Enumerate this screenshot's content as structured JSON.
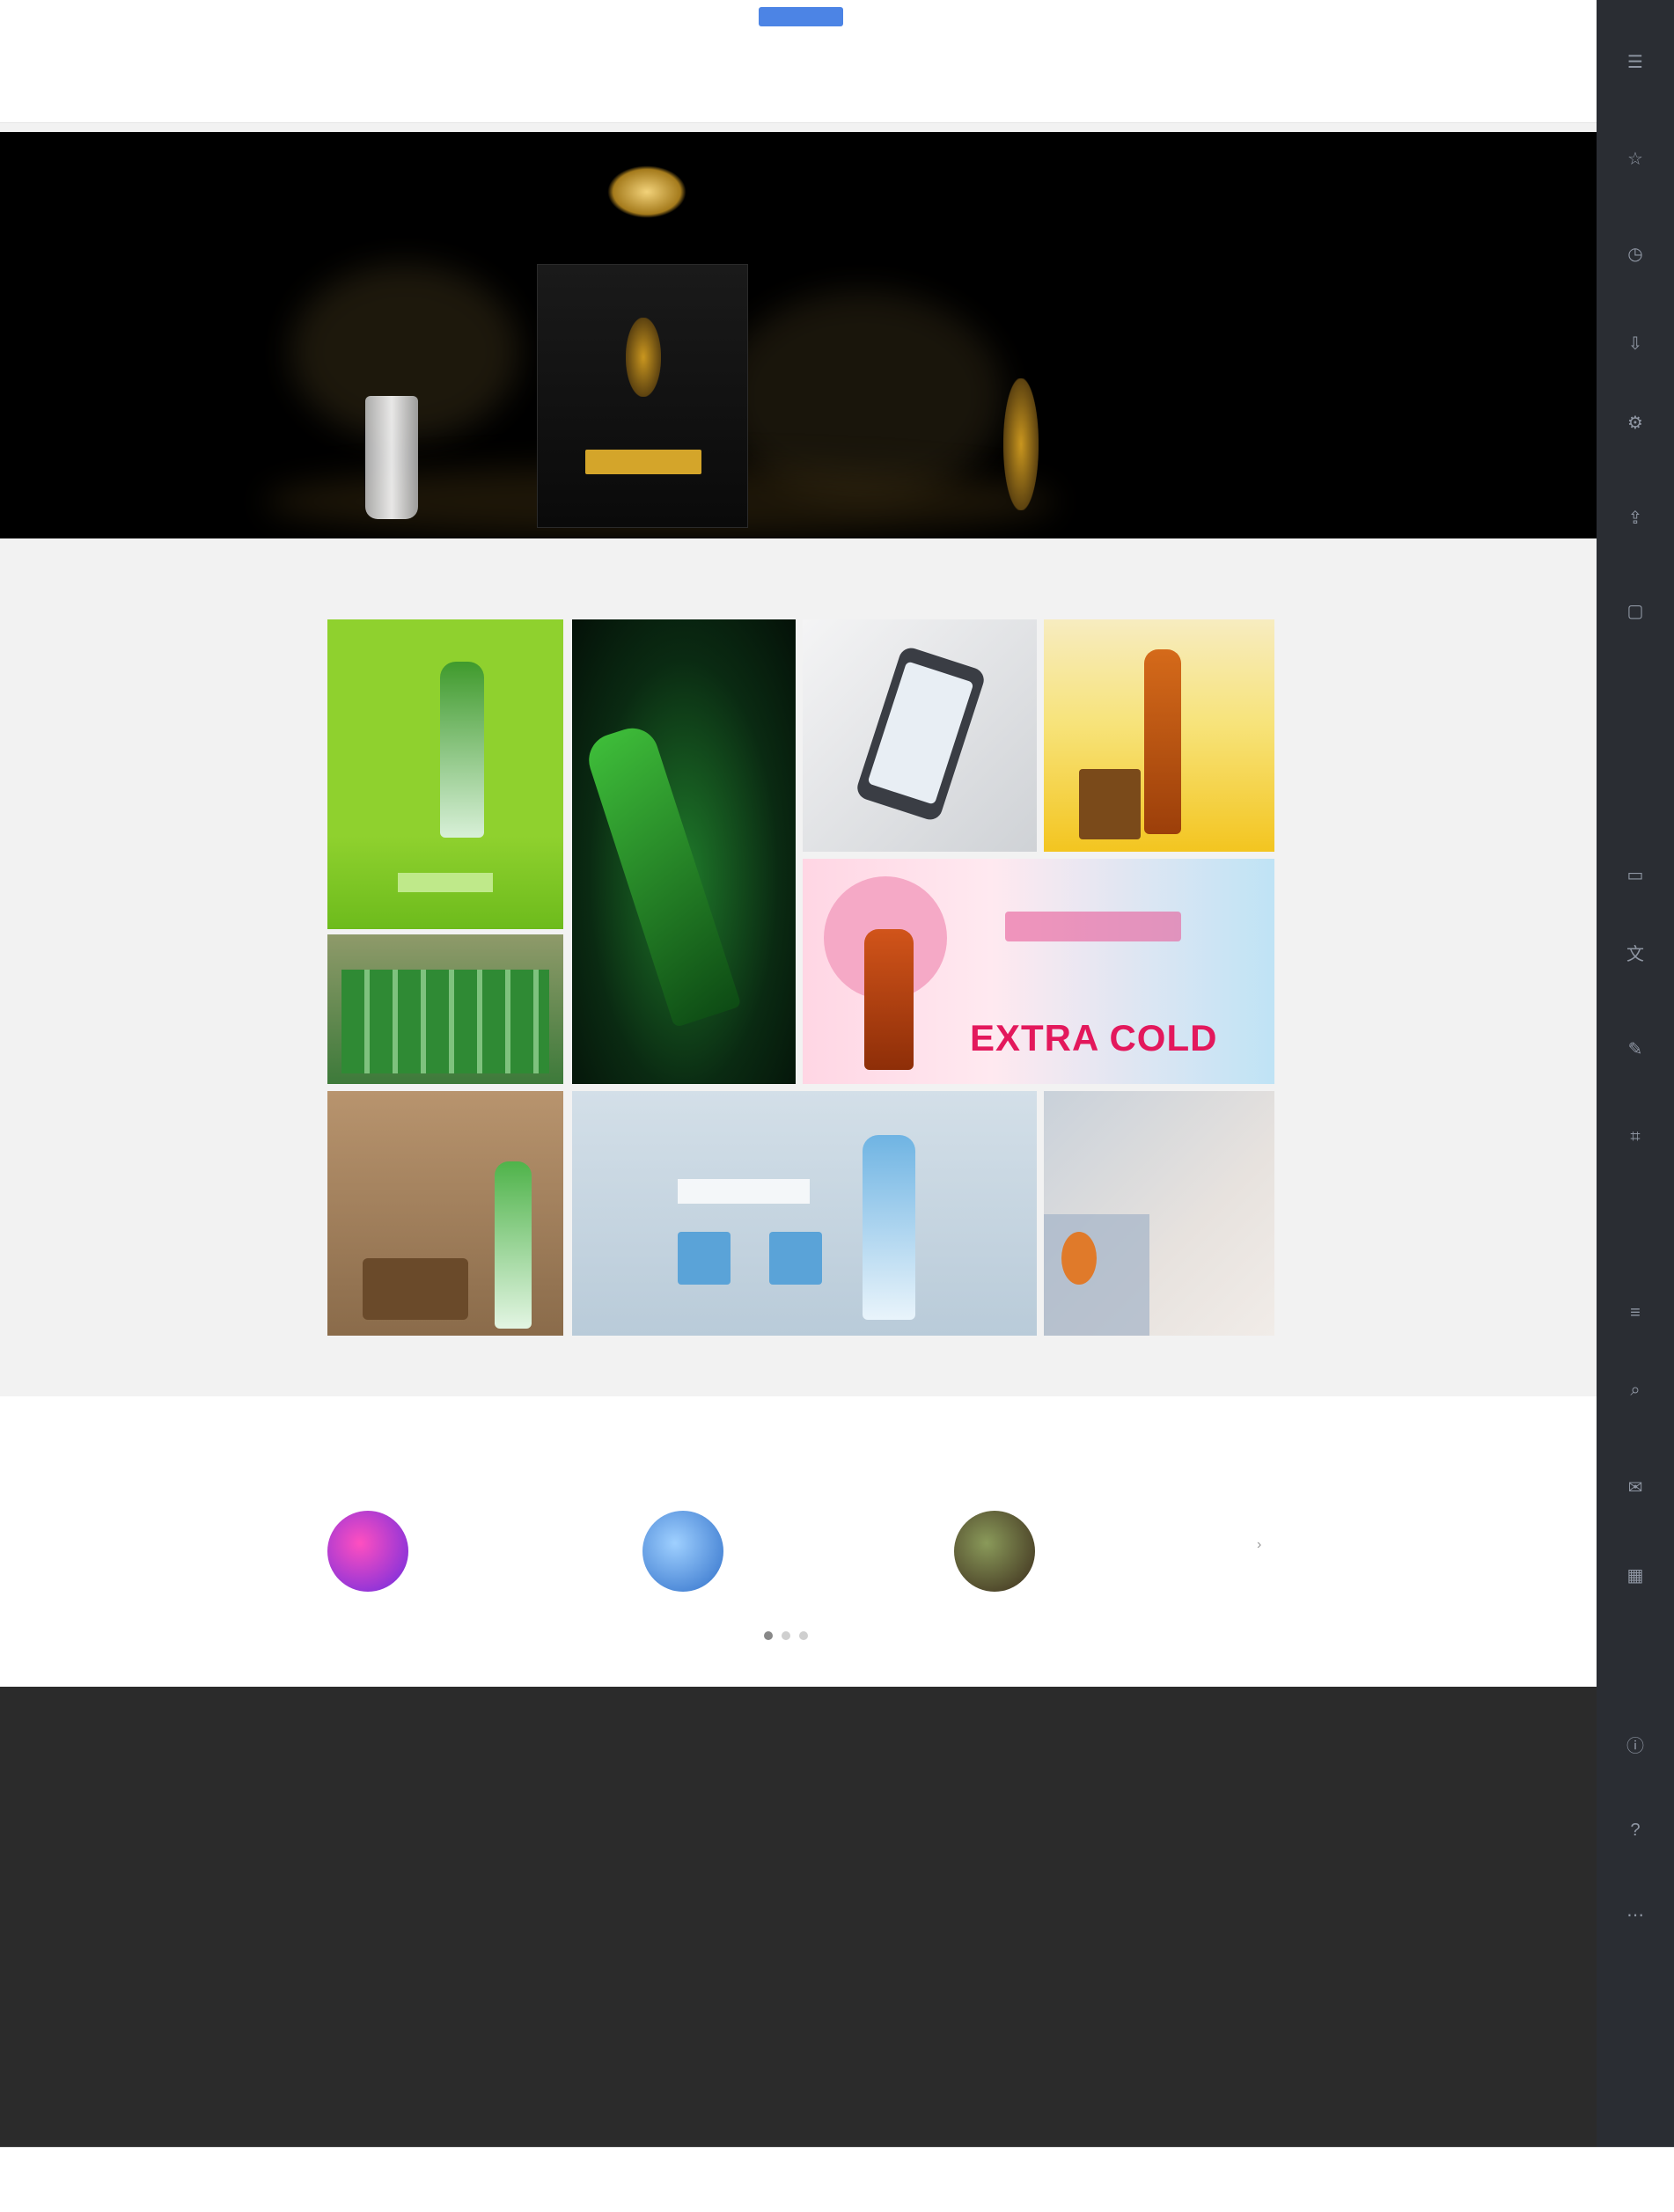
{
  "header": {
    "nav": [
      "",
      "",
      "",
      ""
    ],
    "languages": [
      "",
      "",
      "",
      ""
    ]
  },
  "hero": {
    "headline_1": "",
    "headline_2": "",
    "sub": ""
  },
  "gallery": {
    "title": "",
    "tiles": [
      {
        "name": "tile-green-soju",
        "colors": [
          "#8fd12e",
          "#6dbb1c"
        ]
      },
      {
        "name": "tile-dark-green-bottle",
        "colors": [
          "#0a2a12",
          "#1f7a2a"
        ]
      },
      {
        "name": "tile-phone",
        "colors": [
          "#e9e9ea",
          "#cfd2d6"
        ]
      },
      {
        "name": "tile-yellow-beer",
        "colors": [
          "#f7e37a",
          "#f3c520"
        ]
      },
      {
        "name": "tile-soju-row",
        "colors": [
          "#6f8a5a",
          "#3d7a3a"
        ]
      },
      {
        "name": "tile-extra-cold",
        "colors": [
          "#ffd6e4",
          "#bfe3f5"
        ]
      },
      {
        "name": "tile-wood-soju",
        "colors": [
          "#b8946e",
          "#8a6b4a"
        ]
      },
      {
        "name": "tile-blue-banner",
        "colors": [
          "#c8d6e2",
          "#b9cbd9"
        ]
      },
      {
        "name": "tile-interior",
        "colors": [
          "#e7e2de",
          "#c9d1da"
        ]
      }
    ],
    "extra_cold_text": "EXTRA COLD"
  },
  "instagram": {
    "title": "",
    "cards": [
      {
        "user": "",
        "desc": "",
        "color": "#d83fbf"
      },
      {
        "user": "",
        "desc": "",
        "color": "#3a7bd5"
      },
      {
        "user": "",
        "desc": "",
        "color": "#4a5a3a"
      }
    ],
    "next_icon": "›"
  },
  "footer": {
    "columns": [
      {
        "head": "",
        "items": [
          "",
          "",
          "",
          ""
        ]
      },
      {
        "head": "",
        "items": [
          "",
          "",
          ""
        ]
      },
      {
        "head": "",
        "items": [
          "",
          ""
        ]
      },
      {
        "head": "",
        "items": [
          "",
          ""
        ]
      },
      {
        "head": "",
        "items": [
          "",
          "",
          "",
          "",
          ""
        ]
      }
    ],
    "links": [
      "",
      "",
      "",
      "",
      "",
      "",
      "",
      "",
      ""
    ],
    "copyright": ""
  },
  "side_icons": [
    "menu-icon",
    "bookmark-icon",
    "history-icon",
    "download-icon",
    "settings-icon",
    "share-icon",
    "window-icon",
    "tab-icon",
    "translate-icon",
    "note-icon",
    "capture-icon",
    "reader-icon",
    "search-icon",
    "mail-icon",
    "calendar-icon",
    "info-icon",
    "help-icon"
  ]
}
